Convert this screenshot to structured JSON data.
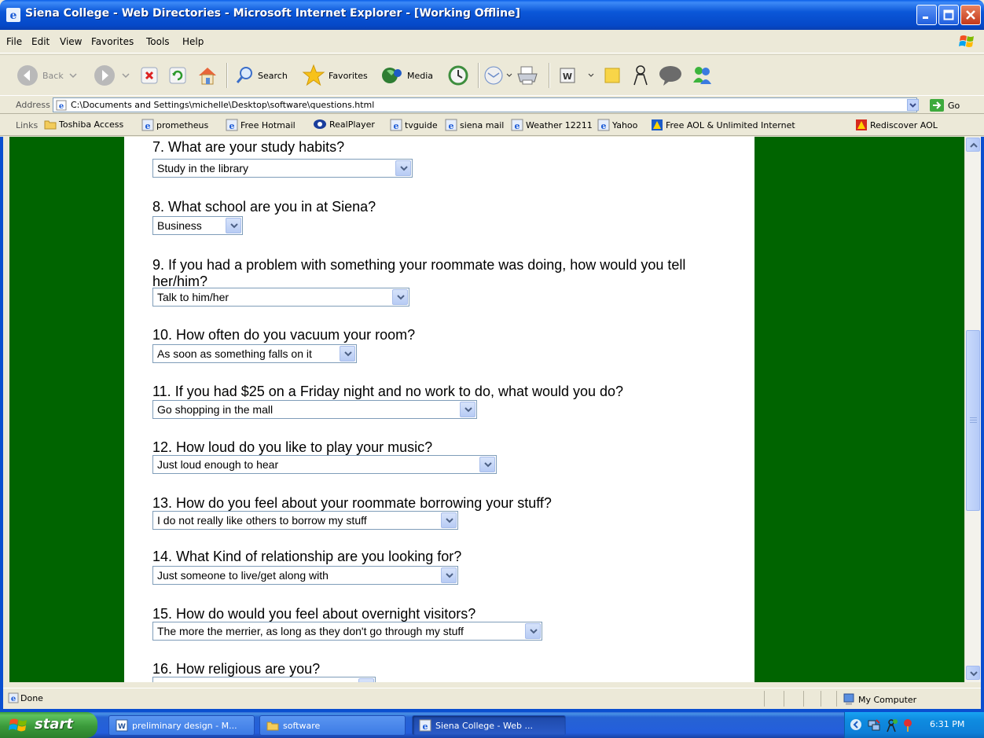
{
  "window": {
    "title": "Siena College - Web Directories - Microsoft Internet Explorer - [Working Offline]"
  },
  "menu": [
    "File",
    "Edit",
    "View",
    "Favorites",
    "Tools",
    "Help"
  ],
  "toolbar": {
    "back_label": "Back",
    "search_label": "Search",
    "favorites_label": "Favorites",
    "media_label": "Media"
  },
  "address": {
    "label": "Address",
    "url": "C:\\Documents and Settings\\michelle\\Desktop\\software\\questions.html",
    "go_label": "Go"
  },
  "links": {
    "label": "Links",
    "items": [
      {
        "label": "Toshiba Access",
        "icon": "folder-icon"
      },
      {
        "label": "prometheus",
        "icon": "ie-page-icon"
      },
      {
        "label": "Free Hotmail",
        "icon": "ie-page-icon"
      },
      {
        "label": "RealPlayer",
        "icon": "realplayer-icon"
      },
      {
        "label": "tvguide",
        "icon": "ie-page-icon"
      },
      {
        "label": "siena mail",
        "icon": "ie-page-icon"
      },
      {
        "label": "Weather 12211",
        "icon": "ie-page-icon"
      },
      {
        "label": "Yahoo",
        "icon": "ie-page-icon"
      },
      {
        "label": "Free AOL & Unlimited Internet",
        "icon": "aol-icon"
      },
      {
        "label": "Rediscover AOL",
        "icon": "aol-icon"
      }
    ]
  },
  "questions": [
    {
      "text": "7. What are your study habits?",
      "answer": "Study in the library"
    },
    {
      "text": "8. What school are you in at Siena?",
      "answer": "Business"
    },
    {
      "text": "9. If you had a problem with something your roommate was doing, how would you tell",
      "text2": "her/him?",
      "answer": "Talk to him/her"
    },
    {
      "text": "10. How often do you vacuum your room?",
      "answer": "As soon as something falls on it"
    },
    {
      "text": "11. If you had $25 on a Friday night and no work to do, what would you do?",
      "answer": "Go shopping in the mall"
    },
    {
      "text": "12. How loud do you like to play your music?",
      "answer": "Just loud enough to hear"
    },
    {
      "text": "13. How do you feel about your roommate borrowing your stuff?",
      "answer": "I do not really like others to borrow my stuff"
    },
    {
      "text": "14. What Kind of relationship are you looking for?",
      "answer": "Just someone to live/get along with"
    },
    {
      "text": "15. How do would you feel about overnight visitors?",
      "answer": "The more the merrier, as long as they don't go through my stuff"
    },
    {
      "text": "16. How religious are you?",
      "answer": ""
    }
  ],
  "status": {
    "text": "Done",
    "zone": "My Computer"
  },
  "taskbar": {
    "start_label": "start",
    "tasks": [
      {
        "label": "preliminary design - M...",
        "icon": "word-icon"
      },
      {
        "label": "software",
        "icon": "folder-icon"
      },
      {
        "label": "Siena College - Web ...",
        "icon": "ie-icon",
        "active": true
      }
    ],
    "clock": "6:31 PM"
  },
  "colors": {
    "page_background": "#006400",
    "content_background": "#FFFFFF"
  }
}
